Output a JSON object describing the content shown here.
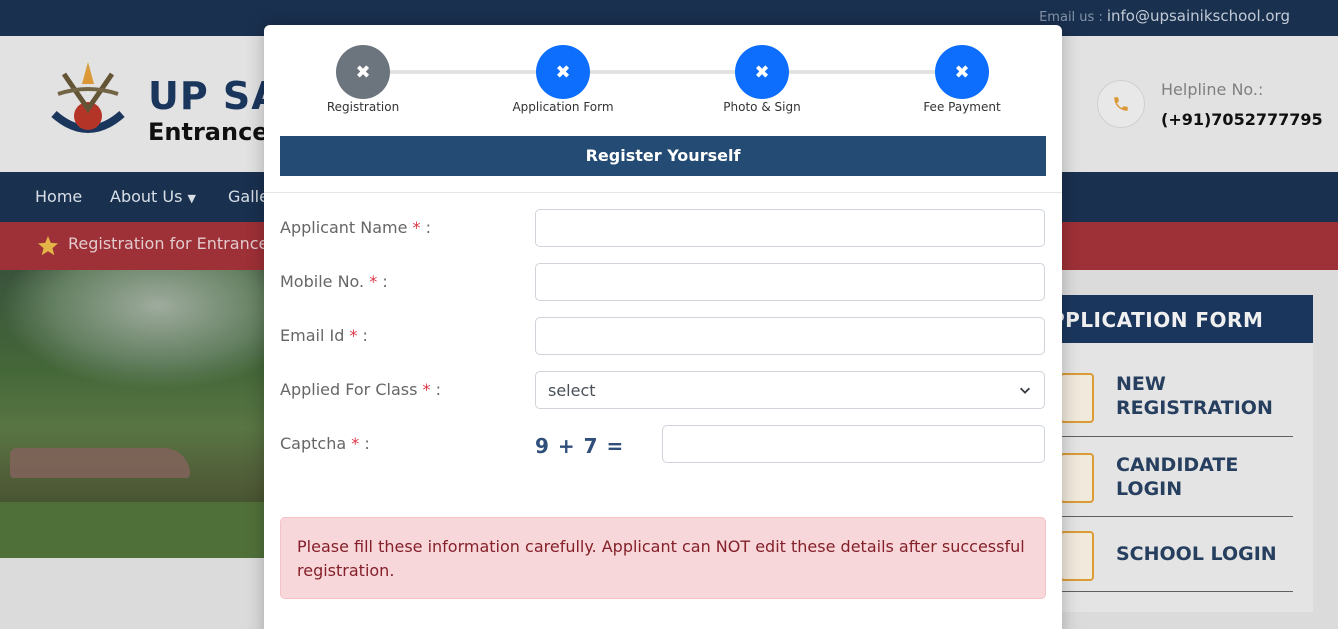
{
  "topbar": {
    "email_label": "Email us :",
    "email": "info@upsainikschool.org"
  },
  "header": {
    "brand_line1": "UP SA",
    "brand_line2": "Entrance E",
    "helpline_label": "Helpline No.:",
    "helpline_number": "(+91)7052777795"
  },
  "nav": {
    "items": [
      "Home",
      "About Us",
      "Galle"
    ]
  },
  "ticker": {
    "text": "Registration for Entrance E"
  },
  "right_panel": {
    "title": "PPLICATION FORM",
    "items": [
      {
        "label_1": "NEW",
        "label_2": "REGISTRATION"
      },
      {
        "label_1": "CANDIDATE",
        "label_2": "LOGIN"
      },
      {
        "label_1": "SCHOOL LOGIN",
        "label_2": ""
      }
    ]
  },
  "modal": {
    "steps": [
      {
        "label": "Registration",
        "icon": "x-icon",
        "state": "done",
        "color": "#6c757d"
      },
      {
        "label": "Application Form",
        "icon": "x-icon",
        "state": "pending",
        "color": "#0d6efd"
      },
      {
        "label": "Photo & Sign",
        "icon": "x-icon",
        "state": "pending",
        "color": "#0d6efd"
      },
      {
        "label": "Fee Payment",
        "icon": "x-icon",
        "state": "pending",
        "color": "#0d6efd"
      }
    ],
    "title": "Register Yourself",
    "form": {
      "applicant_name": {
        "label": "Applicant Name",
        "value": ""
      },
      "mobile": {
        "label": "Mobile No.",
        "value": ""
      },
      "email": {
        "label": "Email Id",
        "value": ""
      },
      "class": {
        "label": "Applied For Class",
        "selected": "select"
      },
      "captcha": {
        "label": "Captcha",
        "question": "9 + 7 =",
        "value": ""
      },
      "required_mark": "*",
      "colon": ":"
    },
    "alert": "Please fill these information carefully. Applicant can NOT edit these details after successful registration."
  },
  "colors": {
    "navy": "#1b3454",
    "accent_blue": "#0d6efd",
    "ticker_red": "#a8333b",
    "title_bar": "#244b73"
  }
}
